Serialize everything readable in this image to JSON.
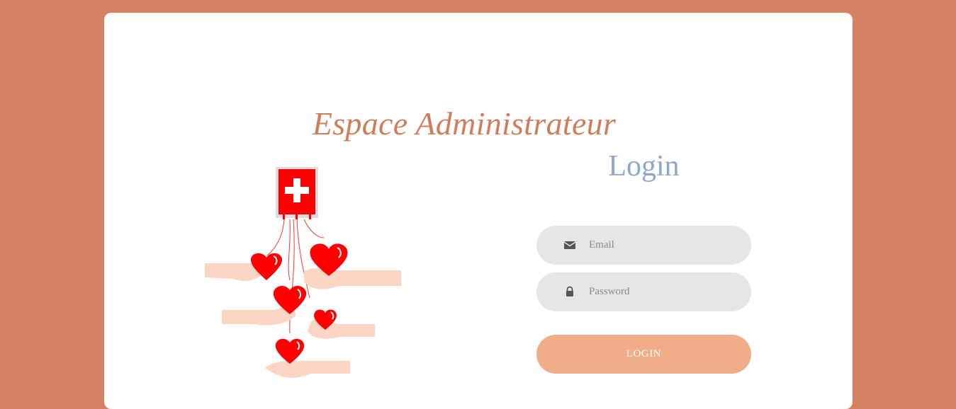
{
  "page": {
    "title": "Espace Administrateur",
    "background_color": "#d68262",
    "accent_color": "#cf7d5c"
  },
  "illustration": {
    "icon": "blood-donation-hearts-illustration",
    "colors": {
      "bag": "#ff0000",
      "heart": "#ff0000",
      "hand": "#fdd5c4"
    }
  },
  "login": {
    "heading": "Login",
    "heading_color": "#8ea6c8",
    "email": {
      "placeholder": "Email",
      "value": "",
      "icon": "envelope-icon"
    },
    "password": {
      "placeholder": "Password",
      "value": "",
      "icon": "lock-icon"
    },
    "submit_label": "LOGIN",
    "submit_color": "#f1ad88"
  }
}
